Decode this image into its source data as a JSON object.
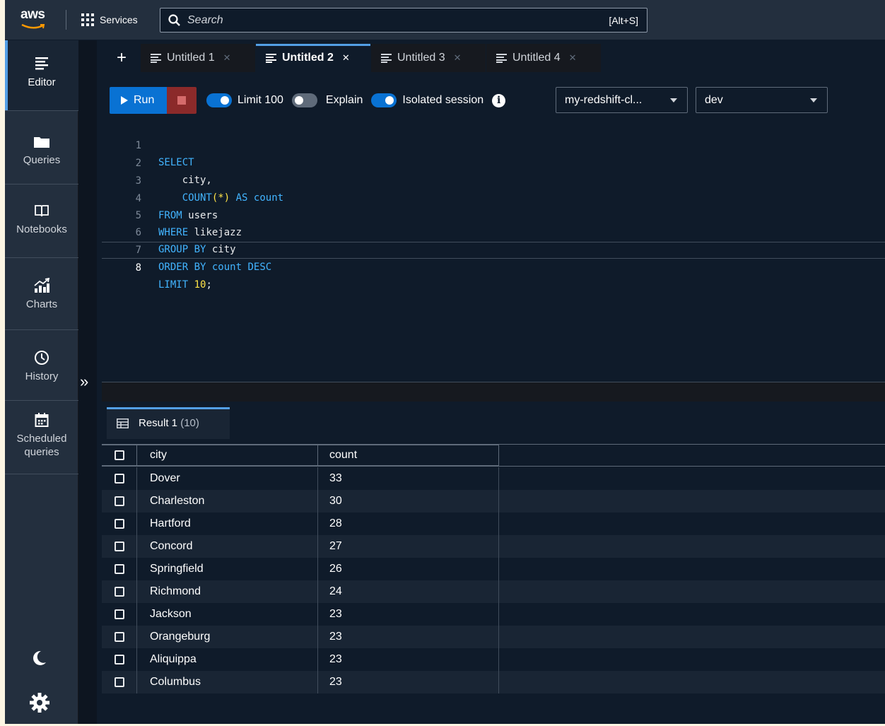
{
  "topnav": {
    "logo_text": "aws",
    "services_label": "Services",
    "search_placeholder": "Search",
    "search_shortcut": "[Alt+S]"
  },
  "sidebar": {
    "items": [
      {
        "label": "Editor",
        "icon": "editor-icon",
        "active": true
      },
      {
        "label": "Queries",
        "icon": "folder-icon"
      },
      {
        "label": "Notebooks",
        "icon": "book-icon"
      },
      {
        "label": "Charts",
        "icon": "chart-icon"
      },
      {
        "label": "History",
        "icon": "clock-icon"
      },
      {
        "label": "Scheduled queries",
        "icon": "calendar-icon"
      }
    ],
    "bottom_icons": [
      "moon-icon",
      "gear-icon"
    ],
    "collapse_glyph": "»"
  },
  "tabs": [
    {
      "label": "Untitled 1",
      "active": false
    },
    {
      "label": "Untitled 2",
      "active": true
    },
    {
      "label": "Untitled 3",
      "active": false
    },
    {
      "label": "Untitled 4",
      "active": false
    }
  ],
  "toolbar": {
    "run_label": "Run",
    "limit_label": "Limit 100",
    "limit_on": true,
    "explain_label": "Explain",
    "explain_on": false,
    "isolated_label": "Isolated session",
    "isolated_on": true,
    "cluster_value": "my-redshift-cl...",
    "database_value": "dev"
  },
  "editor": {
    "lines": [
      {
        "n": "1",
        "code": "SELECT"
      },
      {
        "n": "2",
        "code": "    city,"
      },
      {
        "n": "3",
        "code": "    COUNT(*) AS count"
      },
      {
        "n": "4",
        "code": "FROM users"
      },
      {
        "n": "5",
        "code": "WHERE likejazz"
      },
      {
        "n": "6",
        "code": "GROUP BY city"
      },
      {
        "n": "7",
        "code": "ORDER BY count DESC"
      },
      {
        "n": "8",
        "code": "LIMIT 10;"
      }
    ],
    "current_line": 8
  },
  "results": {
    "tab_label": "Result 1",
    "tab_count": "(10)",
    "columns": [
      "city",
      "count"
    ],
    "rows": [
      [
        "Dover",
        "33"
      ],
      [
        "Charleston",
        "30"
      ],
      [
        "Hartford",
        "28"
      ],
      [
        "Concord",
        "27"
      ],
      [
        "Springfield",
        "26"
      ],
      [
        "Richmond",
        "24"
      ],
      [
        "Jackson",
        "23"
      ],
      [
        "Orangeburg",
        "23"
      ],
      [
        "Aliquippa",
        "23"
      ],
      [
        "Columbus",
        "23"
      ]
    ]
  },
  "colors": {
    "accent": "#539fe5",
    "primary_button": "#0972d3",
    "nav_bg": "#232f3e",
    "page_bg": "#0f1b2a"
  }
}
